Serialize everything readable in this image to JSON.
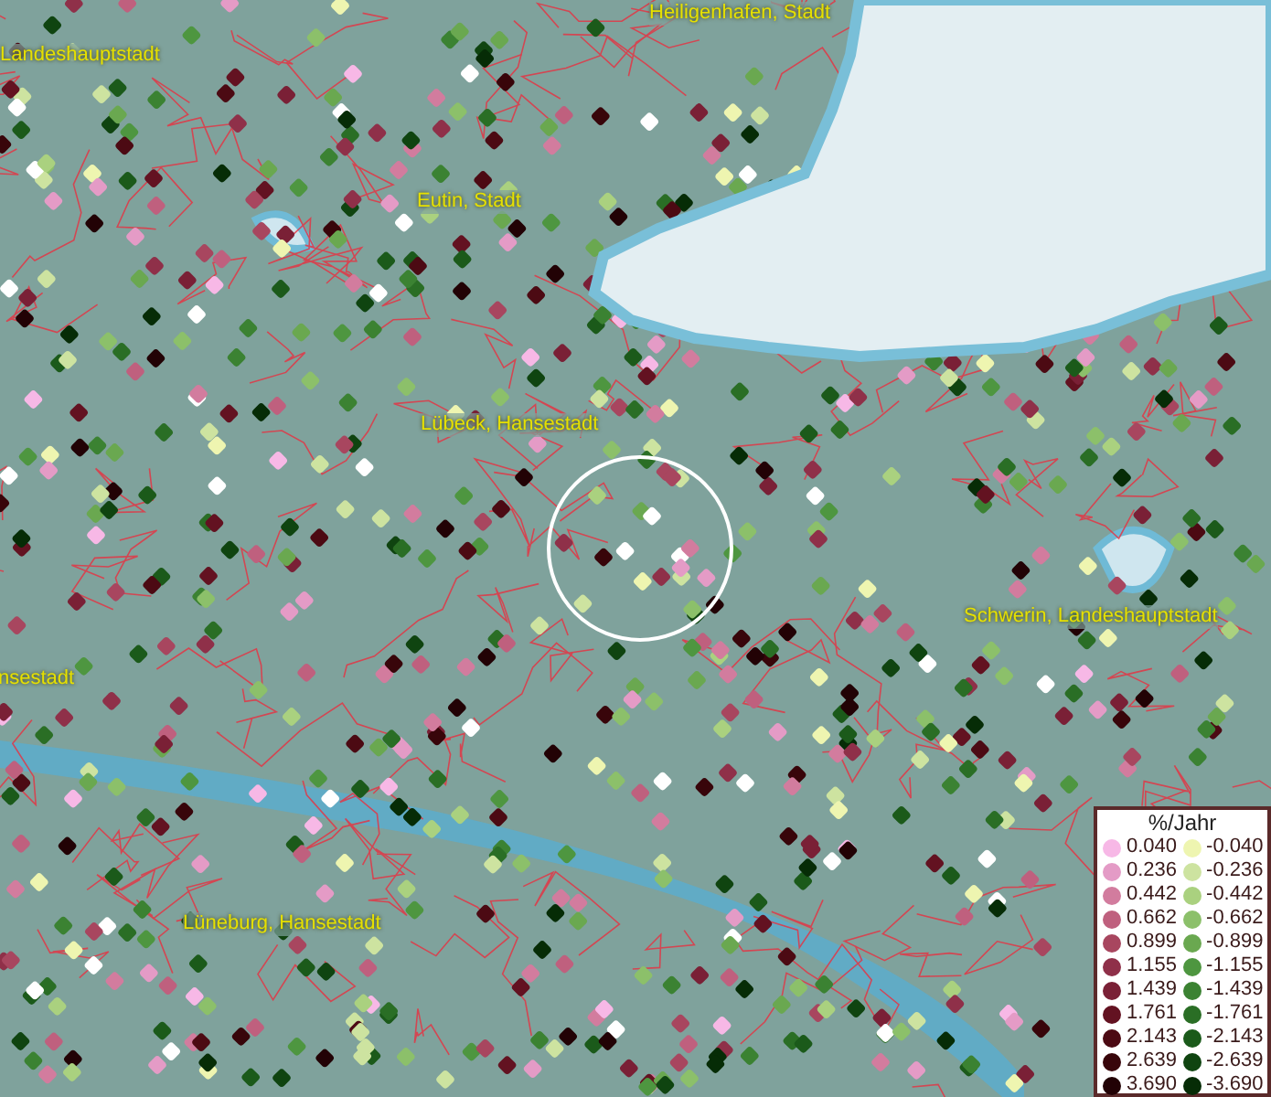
{
  "map": {
    "place_labels": [
      {
        "text": "Heiligenhafen, Stadt"
      },
      {
        "text": "Landeshauptstadt"
      },
      {
        "text": "Eutin, Stadt"
      },
      {
        "text": "Lübeck, Hansestadt"
      },
      {
        "text": "Schwerin, Landeshauptstadt"
      },
      {
        "text": "nsestadt"
      },
      {
        "text": "Lüneburg, Hansestadt"
      }
    ]
  },
  "legend": {
    "title": "%/Jahr",
    "columns": [
      [
        {
          "label": "0.040",
          "color": "#f7b8e6"
        },
        {
          "label": "0.236",
          "color": "#e49bc6"
        },
        {
          "label": "0.442",
          "color": "#d27c9e"
        },
        {
          "label": "0.662",
          "color": "#bf607e"
        },
        {
          "label": "0.899",
          "color": "#a8465f"
        },
        {
          "label": "1.155",
          "color": "#8f3049"
        },
        {
          "label": "1.439",
          "color": "#7a2036"
        },
        {
          "label": "1.761",
          "color": "#631221"
        },
        {
          "label": "2.143",
          "color": "#4c0a13"
        },
        {
          "label": "2.639",
          "color": "#38050a"
        },
        {
          "label": "3.690",
          "color": "#220205"
        }
      ],
      [
        {
          "label": "-0.040",
          "color": "#eef5b0"
        },
        {
          "label": "-0.236",
          "color": "#cde3a0"
        },
        {
          "label": "-0.442",
          "color": "#aad17f"
        },
        {
          "label": "-0.662",
          "color": "#8cc06a"
        },
        {
          "label": "-0.899",
          "color": "#6aa850"
        },
        {
          "label": "-1.155",
          "color": "#4e9640"
        },
        {
          "label": "-1.439",
          "color": "#3b8232"
        },
        {
          "label": "-1.761",
          "color": "#2a6e25"
        },
        {
          "label": "-2.143",
          "color": "#1b5a1a"
        },
        {
          "label": "-2.639",
          "color": "#0f4410"
        },
        {
          "label": "-3.690",
          "color": "#062c06"
        }
      ]
    ]
  }
}
